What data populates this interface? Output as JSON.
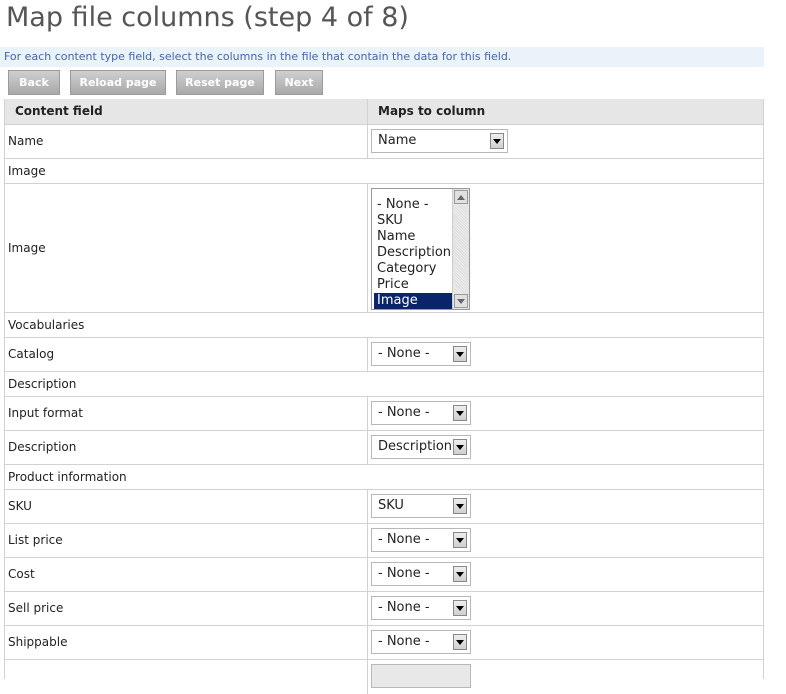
{
  "page": {
    "title": "Map file columns (step 4 of 8)",
    "help_text": "For each content type field, select the columns in the file that contain the data for this field."
  },
  "buttons": {
    "back": "Back",
    "reload": "Reload page",
    "reset": "Reset page",
    "next": "Next"
  },
  "table": {
    "headers": {
      "content_field": "Content field",
      "maps_to": "Maps to column"
    },
    "rows": [
      {
        "label": "Name",
        "value": "Name"
      },
      {
        "label": "Image"
      },
      {
        "label": "Image",
        "options": [
          "- None -",
          "SKU",
          "Name",
          "Description",
          "Category",
          "Price",
          "Image"
        ],
        "selected": "Image"
      },
      {
        "label": "Vocabularies"
      },
      {
        "label": "Catalog",
        "value": "- None -"
      },
      {
        "label": "Description"
      },
      {
        "label": "Input format",
        "value": "- None -"
      },
      {
        "label": "Description",
        "value": "Description"
      },
      {
        "label": "Product information"
      },
      {
        "label": "SKU",
        "value": "SKU"
      },
      {
        "label": "List price",
        "value": "- None -"
      },
      {
        "label": "Cost",
        "value": "- None -"
      },
      {
        "label": "Sell price",
        "value": "- None -"
      },
      {
        "label": "Shippable",
        "value": "- None -"
      }
    ]
  },
  "colors": {
    "title": "#555555",
    "help_bg": "#eaf2fa",
    "help_text": "#4466aa",
    "selected_option": "#0a246a"
  }
}
